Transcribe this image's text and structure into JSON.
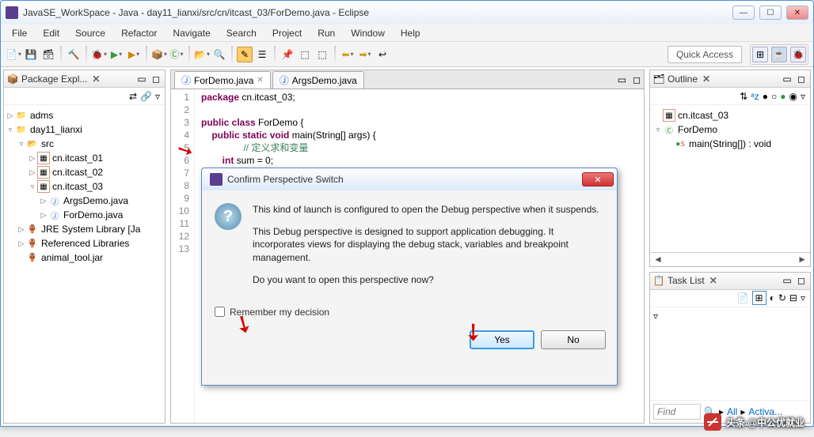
{
  "window": {
    "title": "JavaSE_WorkSpace - Java - day11_lianxi/src/cn/itcast_03/ForDemo.java - Eclipse"
  },
  "menu": [
    "File",
    "Edit",
    "Source",
    "Refactor",
    "Navigate",
    "Search",
    "Project",
    "Run",
    "Window",
    "Help"
  ],
  "quick_access": "Quick Access",
  "package_explorer": {
    "title": "Package Expl...",
    "items": [
      {
        "level": 0,
        "arrow": "▷",
        "icon": "prj",
        "label": "adms"
      },
      {
        "level": 0,
        "arrow": "▿",
        "icon": "prj",
        "label": "day11_lianxi"
      },
      {
        "level": 1,
        "arrow": "▿",
        "icon": "fld",
        "label": "src"
      },
      {
        "level": 2,
        "arrow": "▷",
        "icon": "pkg",
        "label": "cn.itcast_01"
      },
      {
        "level": 2,
        "arrow": "▷",
        "icon": "pkg",
        "label": "cn.itcast_02"
      },
      {
        "level": 2,
        "arrow": "▿",
        "icon": "pkg",
        "label": "cn.itcast_03"
      },
      {
        "level": 3,
        "arrow": "▷",
        "icon": "file",
        "label": "ArgsDemo.java"
      },
      {
        "level": 3,
        "arrow": "▷",
        "icon": "file",
        "label": "ForDemo.java"
      },
      {
        "level": 1,
        "arrow": "▷",
        "icon": "jar",
        "label": "JRE System Library [Ja"
      },
      {
        "level": 1,
        "arrow": "▷",
        "icon": "jar",
        "label": "Referenced Libraries"
      },
      {
        "level": 1,
        "arrow": "",
        "icon": "jar",
        "label": "animal_tool.jar"
      }
    ]
  },
  "editor": {
    "tabs": [
      {
        "label": "ForDemo.java",
        "active": true
      },
      {
        "label": "ArgsDemo.java",
        "active": false
      }
    ],
    "lines": [
      "1",
      "2",
      "3",
      "4",
      "5",
      "6",
      "7",
      "8",
      "9",
      "10",
      "11",
      "12",
      "13"
    ],
    "code": {
      "l1": "package cn.itcast_03;",
      "l3a": "public class ",
      "l3b": "ForDemo {",
      "l4a": "    public static void ",
      "l4b": "main(String[] args) {",
      "l5": "        // 定义求和变量",
      "l6a": "        int ",
      "l6b": "sum = 0;"
    }
  },
  "outline": {
    "title": "Outline",
    "items": [
      {
        "level": 0,
        "arrow": "",
        "icon": "pkg",
        "label": "cn.itcast_03"
      },
      {
        "level": 0,
        "arrow": "▿",
        "icon": "class",
        "label": "ForDemo"
      },
      {
        "level": 1,
        "arrow": "",
        "icon": "method",
        "label": "main(String[]) : void"
      }
    ]
  },
  "tasklist": {
    "title": "Task List",
    "find_placeholder": "Find",
    "all": "All",
    "activate": "Activa..."
  },
  "dialog": {
    "title": "Confirm Perspective Switch",
    "p1": "This kind of launch is configured to open the Debug perspective when it suspends.",
    "p2": "This Debug perspective is designed to support application debugging.  It incorporates views for displaying the debug stack, variables and breakpoint management.",
    "p3": "Do you want to open this perspective now?",
    "remember": "Remember my decision",
    "yes": "Yes",
    "no": "No"
  },
  "watermark": "头条 @中公优就业"
}
